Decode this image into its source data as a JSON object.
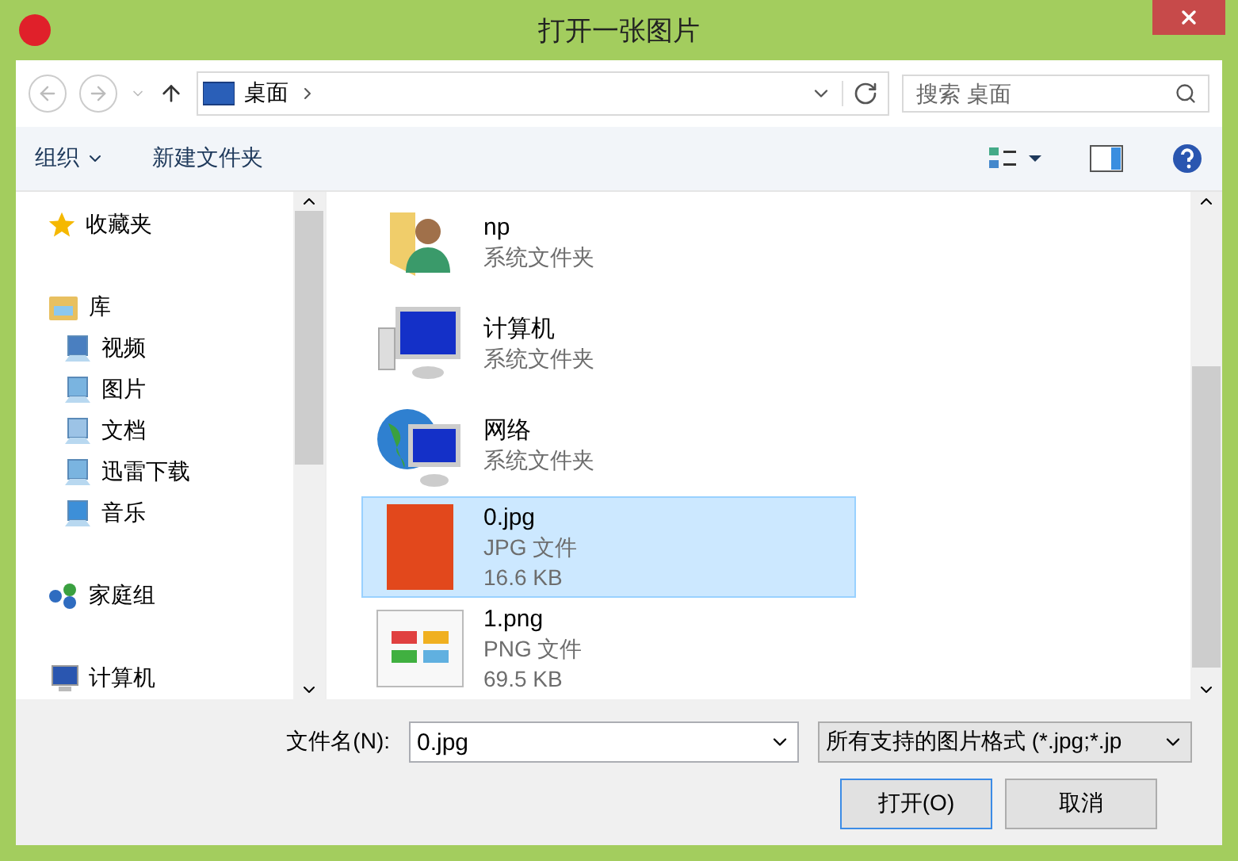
{
  "window": {
    "title": "打开一张图片"
  },
  "nav": {
    "address": "桌面",
    "search": {
      "placeholder": "搜索 桌面"
    }
  },
  "toolbar": {
    "organize": "组织",
    "new_folder": "新建文件夹"
  },
  "sidebar": {
    "items": [
      {
        "label": "收藏夹",
        "kind": "favorites"
      },
      {
        "label": "库",
        "kind": "library",
        "children": [
          {
            "label": "视频",
            "kind": "video"
          },
          {
            "label": "图片",
            "kind": "pictures"
          },
          {
            "label": "文档",
            "kind": "documents"
          },
          {
            "label": "迅雷下载",
            "kind": "downloads"
          },
          {
            "label": "音乐",
            "kind": "music"
          }
        ]
      },
      {
        "label": "家庭组",
        "kind": "homegroup"
      },
      {
        "label": "计算机",
        "kind": "computer"
      }
    ]
  },
  "files": [
    {
      "name": "np",
      "type": "系统文件夹",
      "kind": "user-folder",
      "selected": false
    },
    {
      "name": "计算机",
      "type": "系统文件夹",
      "kind": "computer",
      "selected": false
    },
    {
      "name": "网络",
      "type": "系统文件夹",
      "kind": "network",
      "selected": false
    },
    {
      "name": "0.jpg",
      "type": "JPG 文件",
      "size": "16.6 KB",
      "kind": "photo",
      "selected": true
    },
    {
      "name": "1.png",
      "type": "PNG 文件",
      "size": "69.5 KB",
      "kind": "screenshot",
      "selected": false
    }
  ],
  "footer": {
    "filename_label": "文件名(N):",
    "filename": "0.jpg",
    "filter": "所有支持的图片格式 (*.jpg;*.jp",
    "open": "打开(O)",
    "cancel": "取消"
  }
}
